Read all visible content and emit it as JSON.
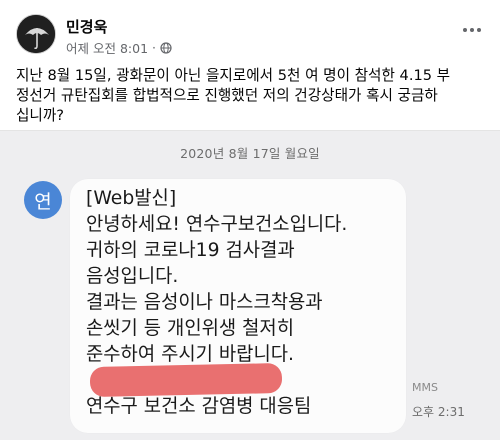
{
  "post": {
    "author": "민경욱",
    "timestamp": "어제 오전 8:01",
    "privacy_icon": "globe-icon",
    "more_icon": "more-options-icon",
    "text_lines": [
      "지난 8월 15일, 광화문이 아닌 을지로에서 5천 여 명이 참석한 4.15 부",
      "정선거 규탄집회를 합법적으로 진행했던 저의 건강상태가 혹시 궁금하",
      "십니까?"
    ]
  },
  "sms_screenshot": {
    "date": "2020년 8월 17일 월요일",
    "sender_initial": "연",
    "message_lines": [
      "[Web발신]",
      "안녕하세요! 연수구보건소입니다.",
      "귀하의 코로나19 검사결과",
      "음성입니다.",
      "결과는 음성이나 마스크착용과",
      "손씻기 등 개인위생 철저히",
      "준수하여 주시기 바랍니다.",
      "",
      "연수구 보건소 감염병 대응팀"
    ],
    "message_type": "MMS",
    "time": "오후 2:31",
    "redaction_color": "#e86a6a"
  },
  "colors": {
    "text_primary": "#050505",
    "text_secondary": "#65676b",
    "sender_avatar": "#4a86d6",
    "chat_background": "#eeeef0"
  }
}
